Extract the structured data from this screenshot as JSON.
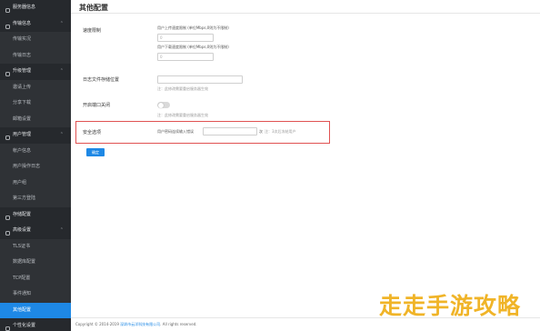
{
  "sidebar": {
    "items": [
      {
        "label": "服务器信息",
        "kind": "section"
      },
      {
        "label": "传输信息",
        "kind": "section"
      },
      {
        "label": "传输实况",
        "kind": "sub"
      },
      {
        "label": "传输日志",
        "kind": "sub"
      },
      {
        "label": "升级管理",
        "kind": "section"
      },
      {
        "label": "邀请上传",
        "kind": "sub"
      },
      {
        "label": "分享下载",
        "kind": "sub"
      },
      {
        "label": "邮箱设置",
        "kind": "sub"
      },
      {
        "label": "用户管理",
        "kind": "section"
      },
      {
        "label": "帐户信息",
        "kind": "sub"
      },
      {
        "label": "用户操作日志",
        "kind": "sub"
      },
      {
        "label": "用户组",
        "kind": "sub"
      },
      {
        "label": "第三方登陆",
        "kind": "sub"
      },
      {
        "label": "存储配置",
        "kind": "section"
      },
      {
        "label": "高级设置",
        "kind": "section"
      },
      {
        "label": "TLS证书",
        "kind": "sub"
      },
      {
        "label": "数据库配置",
        "kind": "sub"
      },
      {
        "label": "TCP配置",
        "kind": "sub"
      },
      {
        "label": "事件通知",
        "kind": "sub"
      },
      {
        "label": "其他配置",
        "kind": "sub-active"
      },
      {
        "label": "个性化设置",
        "kind": "section"
      }
    ]
  },
  "main": {
    "title": "其他配置",
    "speed_limit": {
      "label": "速度限制",
      "upload_label": "用户上传速度限制 (单位Mbps,0则为不限制)",
      "upload_value": "0",
      "download_label": "用户下载速度限制 (单位Mbps,0则为不限制)",
      "download_value": "0"
    },
    "log_storage": {
      "label": "日志文件存储位置",
      "value": "",
      "hint": "注：此修改需要重启服务器生效"
    },
    "port_close": {
      "label": "开启端口关闭",
      "on": false,
      "hint": "注：此修改需要重启服务器生效"
    },
    "security": {
      "label": "安全选项",
      "field_text": "用户密码连续输入错误",
      "field_suffix": "次",
      "hint": "注：3次后冻结用户"
    },
    "confirm_button": "确定"
  },
  "footer": {
    "copyright": "Copyright © 2014-2019",
    "company": "深圳市云洋科技有限公司",
    "rights": ". All rights reserved."
  },
  "watermark": "走走手游攻略",
  "colors": {
    "sidebar_bg": "#2f3236",
    "accent": "#1e88e5",
    "highlight_border": "#e05252",
    "watermark": "#f0b428"
  }
}
